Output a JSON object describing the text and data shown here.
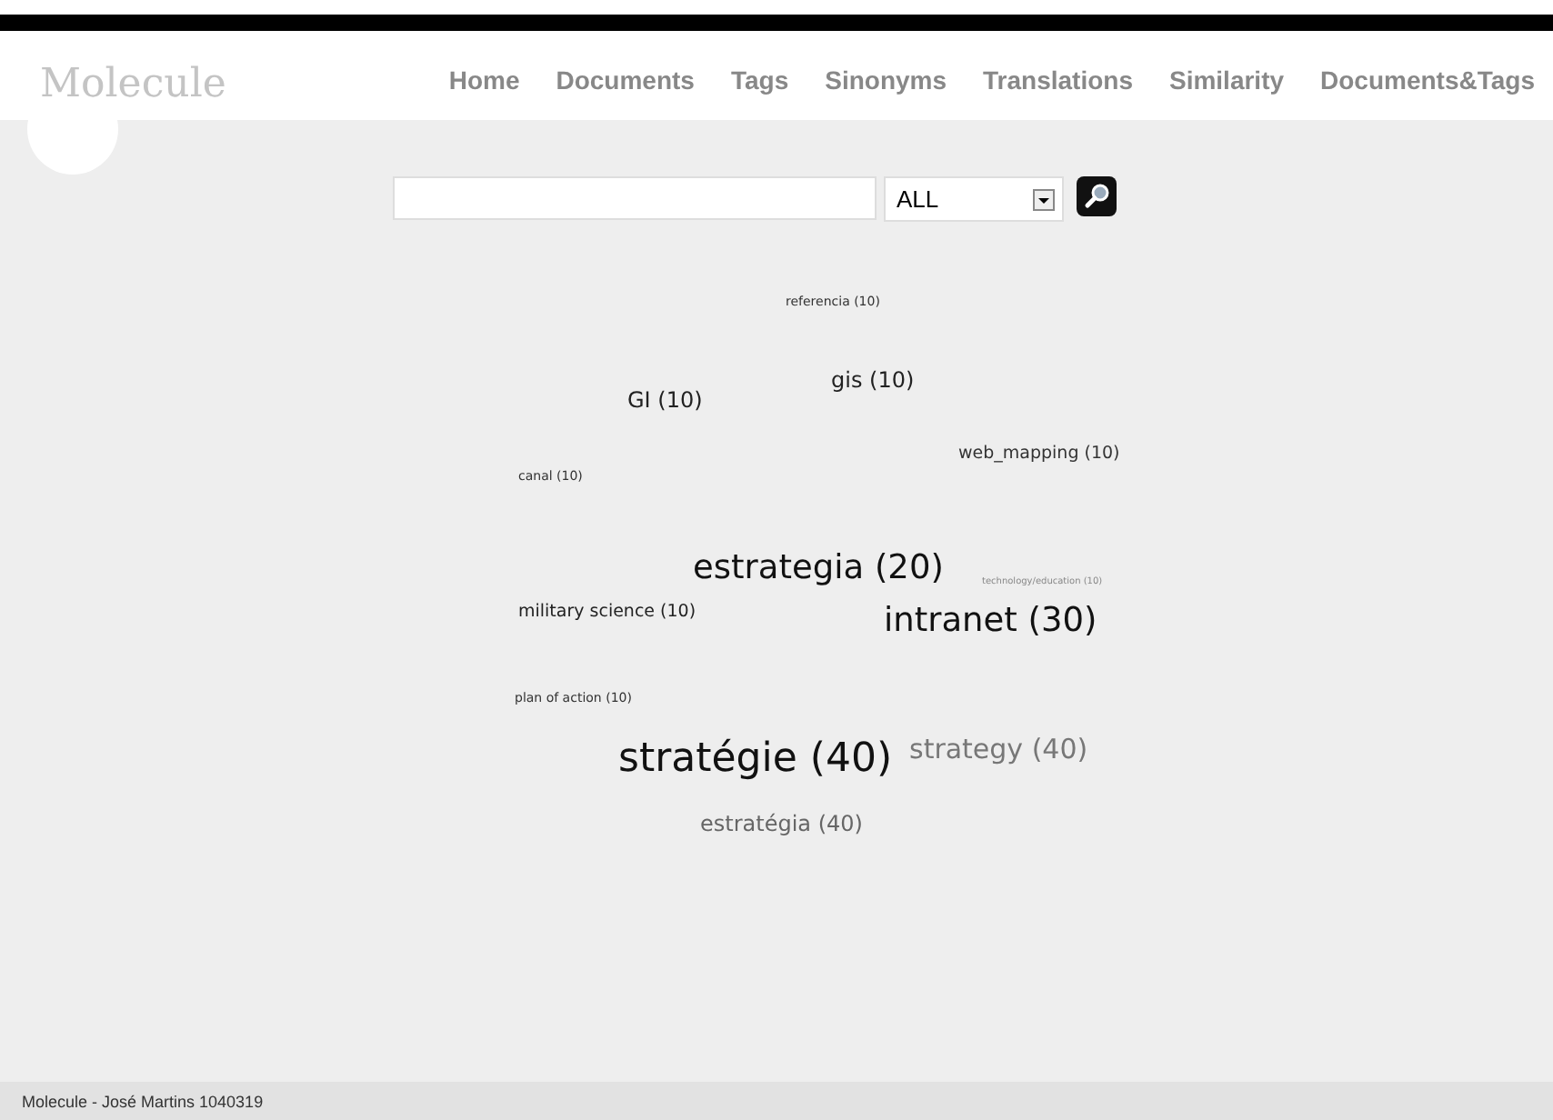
{
  "logo": "Molecule",
  "nav": [
    {
      "label": "Home"
    },
    {
      "label": "Documents"
    },
    {
      "label": "Tags"
    },
    {
      "label": "Sinonyms"
    },
    {
      "label": "Translations"
    },
    {
      "label": "Similarity"
    },
    {
      "label": "Documents&Tags"
    }
  ],
  "search": {
    "filter": "ALL"
  },
  "tag_cloud": [
    {
      "text": "referencia (10)",
      "kind": "tiny",
      "color": "#333333"
    },
    {
      "text": "gis (10)",
      "kind": "medium",
      "color": "#222222"
    },
    {
      "text": "GI (10)",
      "kind": "medium",
      "color": "#222222"
    },
    {
      "text": "web_mapping (10)",
      "kind": "small",
      "color": "#333333"
    },
    {
      "text": "canal (10)",
      "kind": "tiny",
      "color": "#333333"
    },
    {
      "text": "estrategia (20)",
      "kind": "large",
      "color": "#111111"
    },
    {
      "text": "technology/education (10)",
      "kind": "micro",
      "color": "#888888"
    },
    {
      "text": "military science (10)",
      "kind": "small",
      "color": "#222222"
    },
    {
      "text": "intranet (30)",
      "kind": "large",
      "color": "#111111"
    },
    {
      "text": "plan of action (10)",
      "kind": "tiny",
      "color": "#333333"
    },
    {
      "text": "stratégie (40)",
      "kind": "huge",
      "color": "#111111"
    },
    {
      "text": "strategy (40)",
      "kind": "big",
      "color": "#777777"
    },
    {
      "text": "estratégia (40)",
      "kind": "medium",
      "color": "#666666"
    }
  ],
  "footer": "Molecule - José Martins 1040319"
}
